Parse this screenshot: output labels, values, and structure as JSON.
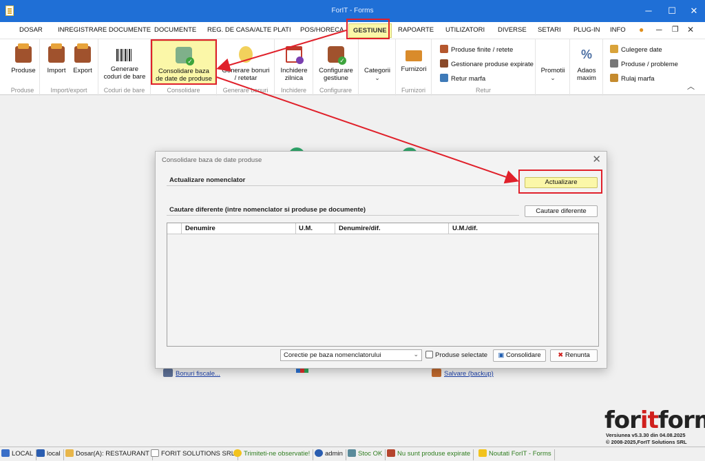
{
  "window": {
    "title": "ForIT - Forms",
    "controls": [
      "minimize-icon",
      "maximize-icon",
      "close-icon"
    ]
  },
  "menu": {
    "items": [
      "DOSAR",
      "INREGISTRARE DOCUMENTE",
      "DOCUMENTE",
      "REG. DE CASA/ALTE PLATI",
      "POS/HORECA",
      "GESTIUNE",
      "RAPOARTE",
      "UTILIZATORI",
      "DIVERSE",
      "SETARI",
      "PLUG-IN",
      "INFO"
    ],
    "active": "GESTIUNE"
  },
  "ribbon": {
    "groups": {
      "produse": "Produse",
      "import_export": "Import/export",
      "coduri": "Coduri de bare",
      "consolidare": "Consolidare",
      "generare_bonuri": "Generare bonuri",
      "inchidere": "Inchidere",
      "configurare": "Configurare",
      "furnizori": "Furnizori",
      "retur": "Retur"
    },
    "buttons": {
      "produse": "Produse",
      "import": "Import",
      "export": "Export",
      "generare_coduri_1": "Generare",
      "generare_coduri_2": "coduri de bare",
      "consolidare_1": "Consolidare baza",
      "consolidare_2": "de date de produse",
      "generare_bonuri_1": "Generare bonuri",
      "generare_bonuri_2": "/ retetar",
      "inchidere_1": "Inchidere",
      "inchidere_2": "zilnica",
      "configurare_1": "Configurare",
      "configurare_2": "gestiune",
      "categorii": "Categorii",
      "furnizori": "Furnizori",
      "produse_finite": "Produse finite / retete",
      "gestionare_expirate": "Gestionare produse expirate",
      "retur_marfa": "Retur marfa",
      "promotii": "Promotii",
      "adaos_1": "Adaos",
      "adaos_2": "maxim",
      "culegere_date": "Culegere date",
      "produse_probleme": "Produse / probleme",
      "rulaj_marfa": "Rulaj marfa"
    }
  },
  "background": {
    "link_bonuri": "Bonuri fiscale...",
    "link_salvare": "Salvare (backup)",
    "logo_for": "for",
    "logo_it": "it",
    "logo_forms": "forms",
    "version": "Versiunea v5.3.30 din 04.08.2025",
    "copyright": "© 2008-2025,ForIT Solutions SRL"
  },
  "dialog": {
    "title": "Consolidare baza de date produse",
    "section_actualizare": "Actualizare nomenclator",
    "btn_actualizare": "Actualizare",
    "section_cautare": "Cautare diferente (intre nomenclator si produse pe documente)",
    "btn_cautare": "Cautare diferente",
    "columns": [
      "Denumire",
      "U.M.",
      "Denumire/dif.",
      "U.M./dif."
    ],
    "combo_value": "Corectie pe baza nomenclatorului",
    "checkbox_label": "Produse selectate",
    "btn_consolidare": "Consolidare",
    "btn_renunta": "Renunta"
  },
  "statusbar": {
    "items": [
      "LOCAL",
      "local",
      "Dosar(A): RESTAURANT",
      "FORIT SOLUTIONS SRL",
      "Trimiteti-ne observatie!",
      "admin",
      "Stoc OK",
      "Nu sunt produse expirate",
      "Noutati ForIT - Forms"
    ]
  },
  "colors": {
    "titlebar": "#1f6fd6",
    "highlight": "#fbf7a8",
    "annotation": "#e0202a"
  }
}
